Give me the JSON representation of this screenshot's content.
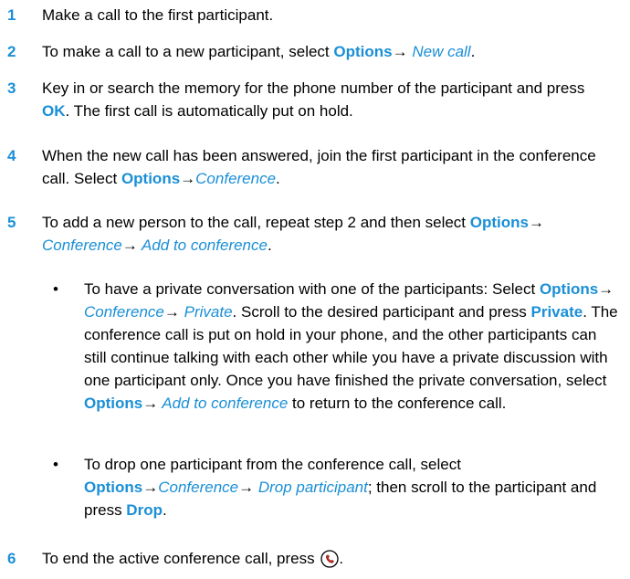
{
  "colors": {
    "accent": "#1a8fd6",
    "text": "#000000"
  },
  "arrow": "→",
  "bullet": "•",
  "steps": [
    {
      "num": "1",
      "t1": "Make a call to the first participant."
    },
    {
      "num": "2",
      "t1": "To make a call to a new participant, select ",
      "k1": "Options",
      "i1": " New call",
      "t2": "."
    },
    {
      "num": "3",
      "t1": "Key in or search the memory for the phone number of the participant and press ",
      "k1": "OK",
      "t2": ". The first call is automatically put on hold."
    },
    {
      "num": "4",
      "t1": "When the new call has been answered, join the first participant in the conference call. Select ",
      "k1": "Options",
      "i1": "Conference",
      "t2": "."
    },
    {
      "num": "5",
      "k1": "Options",
      "i1": " Conference",
      "i2": " Add to conference",
      "t1": "To add a new person to the call, repeat step 2 and then select ",
      "t2": "."
    },
    {
      "num": "6",
      "t1": "To end the active conference call, press ",
      "t2": ".",
      "icon": "end-call-icon"
    }
  ],
  "bullets": [
    {
      "t1": "To have a private conversation with one of the participants: Select ",
      "k1": "Options",
      "i1": " Conference",
      "i2": " Private",
      "t2": ". Scroll to the desired participant and press ",
      "k2": "Private",
      "t3": ". The conference call is put on hold in your phone, and the other participants can still continue talking with each other while you have a private discussion with one participant only. Once you have finished the private conversation, select ",
      "k3": "Options",
      "i3": " Add to conference",
      "t4": " to return to the conference call."
    },
    {
      "t1": "To drop one participant from the conference call, select ",
      "k1": "Options",
      "i1": "Conference",
      "i2": " Drop participant",
      "t2": "; then scroll to the participant and press ",
      "k2": "Drop",
      "t3": "."
    }
  ]
}
